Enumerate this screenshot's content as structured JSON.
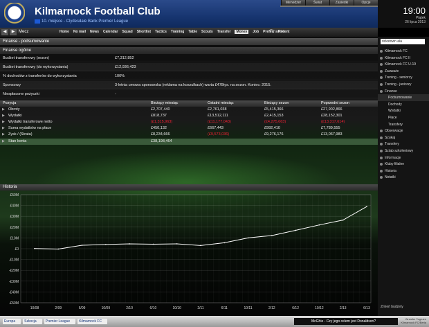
{
  "header": {
    "club_name": "Kilmarnock Football Club",
    "subtitle": "10. miejsce - Clydesdale Bank Premier League",
    "top_menu": [
      "Menedżer",
      "Świat",
      "Zasiedki",
      "Opcje"
    ],
    "clock": {
      "time": "19:00",
      "day": "Piątek",
      "date": "26 lipca 2013"
    }
  },
  "nav": {
    "back": "◀",
    "forward": "▶",
    "crumb": "Mecz",
    "tabs": [
      "Home",
      "No mail",
      "News",
      "Calendar",
      "Squad",
      "Shortlist",
      "Tactics",
      "Training",
      "Table",
      "Scouts",
      "Transfer",
      "Money",
      "Job",
      "Prefer.",
      "Recent"
    ],
    "active_tab": "Money",
    "section": "Finanse"
  },
  "panel": {
    "title": "Finanse - podsumowanie",
    "general_title": "Finanse ogólne",
    "general_rows": [
      {
        "label": "Budżet transferowy (sezon)",
        "value": "£7,312,852"
      },
      {
        "label": "Budżet transferowy (do wykorzystania)",
        "value": "£12,936,423"
      },
      {
        "label": "% dochodów z transferów do wykorzystania",
        "value": "100%"
      },
      {
        "label": "Sponsorzy",
        "value": "3-letnia umowa sponsorska (reklama na koszulkach) warta £478tys. na sezon. Koniec: 2015."
      },
      {
        "label": "Niespłacone pożyczki",
        "value": "-"
      }
    ]
  },
  "table": {
    "headers": [
      "Pozycja",
      "Bieżący miesiąc",
      "Ostatni miesiąc",
      "Bieżący sezon",
      "Poprzedni sezon"
    ],
    "rows": [
      {
        "name": "Obroty",
        "cells": [
          "£2,707,440",
          "£2,761,038",
          "£5,415,366",
          "£27,902,866"
        ]
      },
      {
        "name": "Wydatki",
        "cells": [
          "£818,737",
          "£13,512,111",
          "£2,415,153",
          "£28,152,301"
        ]
      },
      {
        "name": "Wydatki transferowe netto",
        "cells": [
          "(£1,315,963)",
          "(£11,177,043)",
          "(£4,275,663)",
          "(£13,317,614)"
        ]
      },
      {
        "name": "Suma wydatków na płace",
        "cells": [
          "£450,132",
          "£667,443",
          "£992,410",
          "£7,789,555"
        ]
      },
      {
        "name": "Zysk / (Strata)",
        "cells": [
          "£8,234,666",
          "(£9,573,036)",
          "£9,276,176",
          "£13,067,983"
        ]
      },
      {
        "name": "Stan konta",
        "cells": [
          "£38,198,464",
          "",
          "",
          ""
        ]
      }
    ]
  },
  "history": {
    "title": "Historia"
  },
  "chart_data": {
    "type": "line",
    "x": [
      "10/08",
      "2/09",
      "6/09",
      "10/09",
      "2/10",
      "6/10",
      "10/10",
      "2/11",
      "6/11",
      "10/11",
      "2/12",
      "6/12",
      "10/12",
      "2/13",
      "6/13"
    ],
    "y_tick_labels": [
      "£50M",
      "£40M",
      "£30M",
      "£20M",
      "£10M",
      "£0",
      "-£10M",
      "-£20M",
      "-£30M",
      "-£40M",
      "-£50M"
    ],
    "ylim": [
      -50,
      50
    ],
    "series": [
      {
        "values": [
          0.2,
          -0.3,
          3.2,
          3.9,
          4.5,
          4.2,
          4.5,
          3.0,
          5.5,
          10.0,
          12.2,
          17.0,
          22.0,
          26.5,
          39.0
        ]
      }
    ],
    "line_color": "#ffffff",
    "grid": true
  },
  "sidebar": {
    "search_value": "rickstown ala",
    "items": [
      {
        "label": "Kilmarnock FC",
        "sub": false
      },
      {
        "label": "Kilmarnock FC II",
        "sub": false
      },
      {
        "label": "Kilmarnock FC U-19",
        "sub": false
      },
      {
        "label": "Zauważe",
        "sub": false
      },
      {
        "label": "Trening - seniorzy",
        "sub": false
      },
      {
        "label": "Trening - juniorzy",
        "sub": false
      },
      {
        "label": "Finanse",
        "sub": false
      },
      {
        "label": "Podsumowanie",
        "sub": true
      },
      {
        "label": "Dochody",
        "sub": true
      },
      {
        "label": "Wydatki",
        "sub": true
      },
      {
        "label": "Płace",
        "sub": true
      },
      {
        "label": "Transfery",
        "sub": true
      },
      {
        "label": "Obserwacje",
        "sub": false
      },
      {
        "label": "Szukaj",
        "sub": false
      },
      {
        "label": "Transfery",
        "sub": false
      },
      {
        "label": "Sztab szkoleniowy",
        "sub": false
      },
      {
        "label": "Informacje",
        "sub": false
      },
      {
        "label": "Kluby filialne",
        "sub": false
      },
      {
        "label": "Historia",
        "sub": false
      },
      {
        "label": "Notatki",
        "sub": false
      }
    ],
    "footer": "Zmień budżety"
  },
  "bottom": {
    "breadcrumbs": [
      "Europa",
      "Szkocja",
      "Premier League",
      "Kilmarnock FC"
    ],
    "news": "McGhie - Czy jego celem jest Donaldson?",
    "tagline": "Wrestler Tagruen\nKilmarnock FC/Beria"
  }
}
